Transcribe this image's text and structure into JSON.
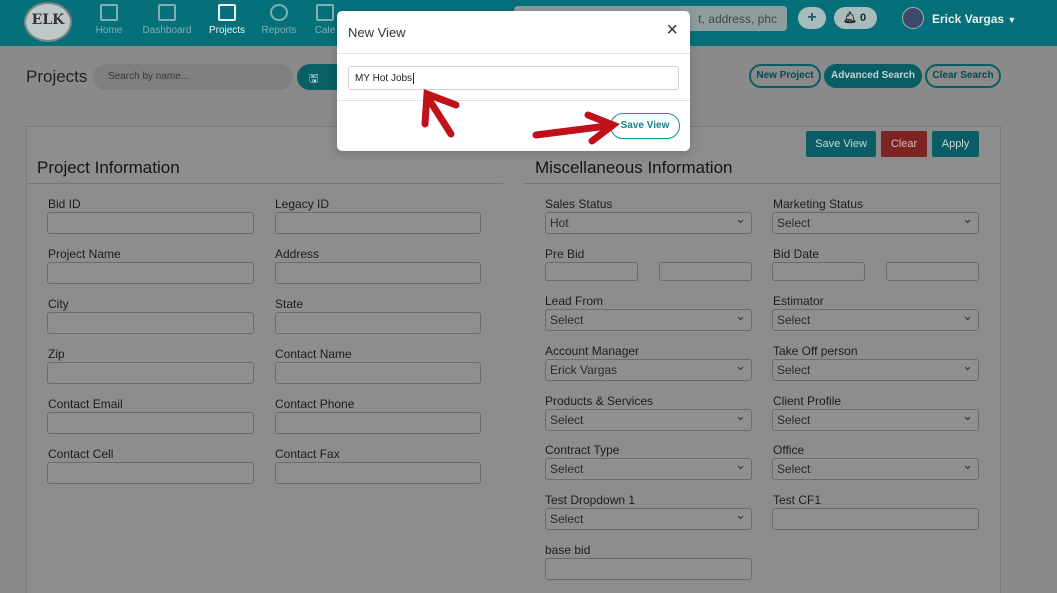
{
  "app": {
    "logo_text": "ELK"
  },
  "nav": {
    "items": [
      {
        "label": "Home"
      },
      {
        "label": "Dashboard"
      },
      {
        "label": "Projects"
      },
      {
        "label": "Reports"
      },
      {
        "label": "Cale"
      }
    ],
    "search_placeholder": "t, address, phc",
    "notifications_count": "0",
    "user_name": "Erick Vargas"
  },
  "page": {
    "title": "Projects",
    "search_placeholder": "Search by name...",
    "buttons": {
      "new_project": "New Project",
      "advanced_search": "Advanced Search",
      "clear_search": "Clear Search"
    }
  },
  "actions": {
    "save_view": "Save View",
    "clear": "Clear",
    "apply": "Apply"
  },
  "project_info": {
    "title": "Project Information",
    "fields": [
      {
        "label": "Bid ID",
        "value": ""
      },
      {
        "label": "Legacy ID",
        "value": ""
      },
      {
        "label": "Project Name",
        "value": ""
      },
      {
        "label": "Address",
        "value": ""
      },
      {
        "label": "City",
        "value": ""
      },
      {
        "label": "State",
        "value": ""
      },
      {
        "label": "Zip",
        "value": ""
      },
      {
        "label": "Contact Name",
        "value": ""
      },
      {
        "label": "Contact Email",
        "value": ""
      },
      {
        "label": "Contact Phone",
        "value": ""
      },
      {
        "label": "Contact Cell",
        "value": ""
      },
      {
        "label": "Contact Fax",
        "value": ""
      }
    ]
  },
  "misc_info": {
    "title": "Miscellaneous Information",
    "sales_status": {
      "label": "Sales Status",
      "value": "Hot"
    },
    "marketing_status": {
      "label": "Marketing Status",
      "value": "Select"
    },
    "pre_bid": {
      "label": "Pre Bid"
    },
    "bid_date": {
      "label": "Bid Date"
    },
    "lead_from": {
      "label": "Lead From",
      "value": "Select"
    },
    "estimator": {
      "label": "Estimator",
      "value": "Select"
    },
    "account_manager": {
      "label": "Account Manager",
      "value": "Erick Vargas"
    },
    "take_off_person": {
      "label": "Take Off person",
      "value": "Select"
    },
    "products_services": {
      "label": "Products & Services",
      "value": "Select"
    },
    "client_profile": {
      "label": "Client Profile",
      "value": "Select"
    },
    "contract_type": {
      "label": "Contract Type",
      "value": "Select"
    },
    "office": {
      "label": "Office",
      "value": "Select"
    },
    "test_dropdown": {
      "label": "Test Dropdown 1",
      "value": "Select"
    },
    "test_cf1": {
      "label": "Test CF1"
    },
    "base_bid": {
      "label": "base bid"
    }
  },
  "modal": {
    "title": "New View",
    "close": "×",
    "input_value": "MY Hot Jobs",
    "save_label": "Save View"
  },
  "colors": {
    "brand": "#138895",
    "annotation_arrow": "#c0101a"
  }
}
